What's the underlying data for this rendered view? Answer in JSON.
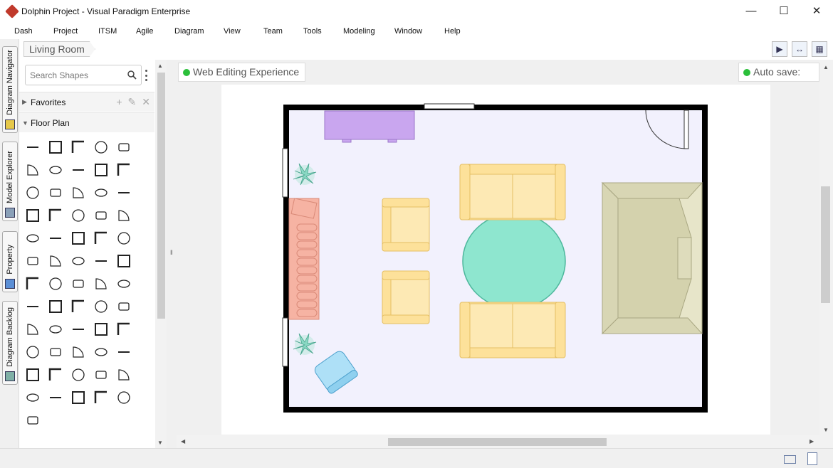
{
  "window": {
    "title": "Dolphin Project - Visual Paradigm Enterprise",
    "controls": [
      "minimize-icon",
      "maximize-icon",
      "close-icon"
    ]
  },
  "menu": [
    "Dash",
    "Project",
    "ITSM",
    "Agile",
    "Diagram",
    "View",
    "Team",
    "Tools",
    "Modeling",
    "Window",
    "Help"
  ],
  "left_tabs": [
    "Diagram Navigator",
    "Model Explorer",
    "Property",
    "Diagram Backlog"
  ],
  "breadcrumb": "Living Room",
  "toolbar_icons": [
    "announce-icon",
    "fit-diagram-icon",
    "panel-layout-icon"
  ],
  "shape_panel": {
    "search_placeholder": "Search Shapes",
    "groups": [
      {
        "label": "Favorites",
        "expanded": false
      },
      {
        "label": "Floor Plan",
        "expanded": true
      }
    ]
  },
  "canvas": {
    "web_editing_label": "Web Editing Experience",
    "autosave_label": "Auto save: On",
    "status_color": "#2bbf3a",
    "floor_color": "#f2f1fd",
    "wall_color": "#000000"
  },
  "status_icons": [
    "mail-icon",
    "notes-icon"
  ]
}
